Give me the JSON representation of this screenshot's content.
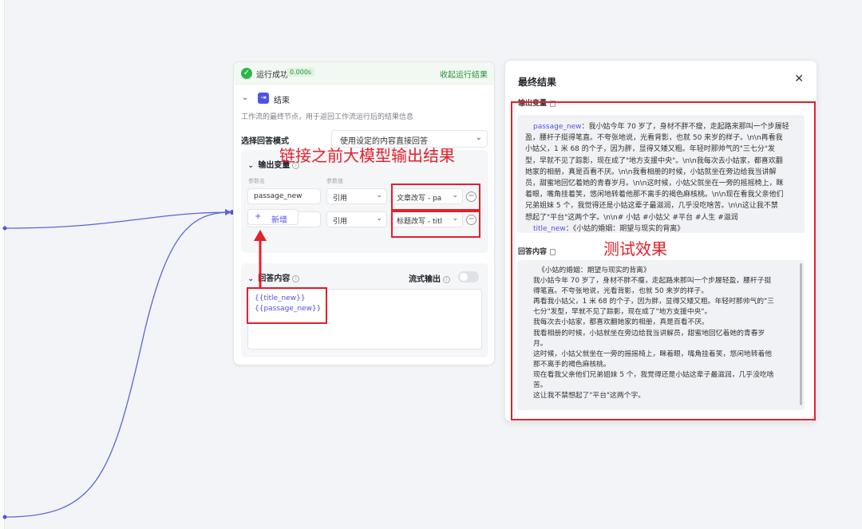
{
  "run": {
    "status": "运行成功",
    "time": "0.000s",
    "collapse": "收起运行结果"
  },
  "node": {
    "title": "结束",
    "desc": "工作流的最终节点，用于返回工作流运行后的结果信息",
    "mode_label": "选择回答模式",
    "mode_value": "使用设定的内容直接回答",
    "output_section": "输出变量",
    "col_name": "参数名",
    "col_value": "参数值",
    "rows": [
      {
        "name": "passage_new",
        "type": "引用",
        "ref": "文章改写 - pa"
      },
      {
        "name": "title_new",
        "type": "引用",
        "ref": "标题改写 - titl"
      }
    ],
    "add_label": "新增",
    "answer_section": "回答内容",
    "stream_label": "流式输出",
    "answer_lines": [
      "{{title_new}}",
      "{{passage_new}}"
    ]
  },
  "panel": {
    "title": "最终结果",
    "output_label": "输出变量",
    "passage_key": "passage_new",
    "passage_lines": [
      "：我小姑今年 70 岁了，身材不胖不瘦，走起路来那叫一个步履轻",
      "盈，腰杆子挺得笔直。不夸张地说，光看背影，也就 50 来岁的样子。\\n\\n再看我",
      "小姑父，1 米 68 的个子，因为胖，显得又矮又粗。年轻时那帅气的\"三七分\"发",
      "型，早就不见了踪影，现在成了\"地方支援中央\"。\\n\\n我每次去小姑家，都喜欢翻",
      "她家的相册，真是百看不厌。\\n\\n我看相册的时候，小姑就坐在旁边给我当讲解",
      "员，甜蜜地回忆着她的青春岁月。\\n\\n这时候，小姑父就坐在一旁的摇摇椅上，眯",
      "着眼，嘴角挂着笑，悠闲地转着他那不离手的褐色麻核桃。\\n\\n现在看我父亲他们",
      "兄弟姐妹 5 个，我觉得还是小姑这辈子最滋润，几乎没吃啥苦。\\n\\n这让我不禁",
      "想起了\"平台\"这两个字。\\n\\n# 小姑 #小姑父 #平台 #人生 #滋润"
    ],
    "title_key": "title_new",
    "title_value": "：《小姑的婚姻：期望与现实的背离》",
    "answer_label": "回答内容",
    "answer_lines": [
      "《小姑的婚姻：期望与现实的背离》",
      "我小姑今年 70 岁了，身材不胖不瘦，走起路来那叫一个步履轻盈，腰杆子挺",
      "得笔直。不夸张地说，光看背影，也就 50 来岁的样子。",
      "再看我小姑父，1 米 68 的个子，因为胖，显得又矮又粗。年轻时那帅气的\"三",
      "七分\"发型，早就不见了踪影，现在成了\"地方支援中央\"。",
      "我每次去小姑家，都喜欢翻她家的相册，真是百看不厌。",
      "我看相册的时候，小姑就坐在旁边给我当讲解员，甜蜜地回忆着她的青春岁",
      "月。",
      "这时候，小姑父就坐在一旁的摇摇椅上，眯着眼，嘴角挂着笑，悠闲地转着他",
      "那不离手的褐色麻核桃。",
      "现在看我父亲他们兄弟姐妹 5 个，我觉得还是小姑这辈子最滋润，几乎没吃啥",
      "苦。",
      "这让我不禁想起了\"平台\"这两个字。"
    ]
  },
  "annotations": {
    "link_note": "链接之前大模型输出结果",
    "test_note": "测试效果"
  },
  "colors": {
    "accent": "#4d53e8",
    "success": "#2fb54a",
    "annotation": "#e3202b"
  },
  "icons": [
    "check-circle-icon",
    "end-node-icon",
    "chevron-down-icon",
    "info-icon",
    "minus-circle-icon",
    "plus-icon",
    "copy-icon",
    "close-icon",
    "arrow-up-icon"
  ]
}
